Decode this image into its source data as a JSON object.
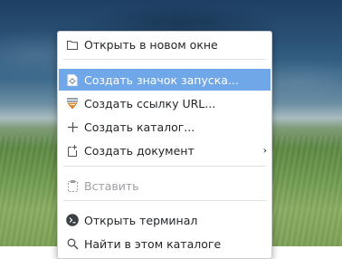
{
  "context_menu": {
    "items": [
      {
        "label": "Открыть в новом окне",
        "icon": "folder-icon"
      },
      {
        "label": "Создать значок запуска...",
        "icon": "launcher-icon",
        "highlighted": true
      },
      {
        "label": "Создать ссылку URL...",
        "icon": "link-icon"
      },
      {
        "label": "Создать каталог...",
        "icon": "plus-icon"
      },
      {
        "label": "Создать документ",
        "icon": "new-document-icon",
        "submenu": true
      },
      {
        "label": "Вставить",
        "icon": "paste-icon",
        "disabled": true
      },
      {
        "label": "Открыть терминал",
        "icon": "terminal-icon"
      },
      {
        "label": "Найти в этом каталоге",
        "icon": "search-icon"
      }
    ],
    "submenu_arrow": "›"
  },
  "colors": {
    "highlight": "#6fa7e8",
    "menu_bg": "#ffffff",
    "text": "#232629",
    "disabled_text": "#9a9ea3"
  }
}
